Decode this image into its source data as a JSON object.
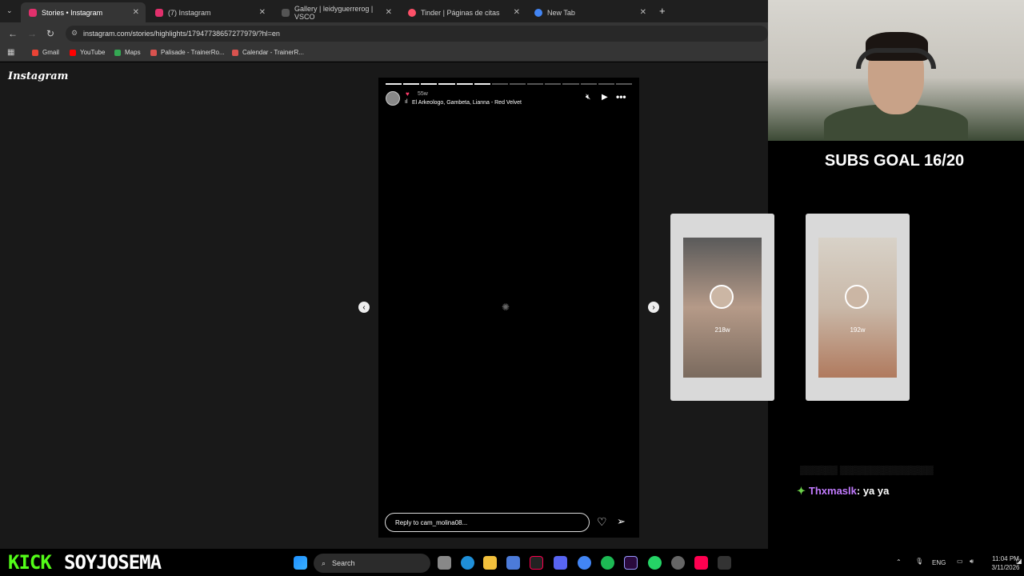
{
  "browser": {
    "tabs": [
      {
        "label": "Stories • Instagram",
        "active": true,
        "color": "#e1306c"
      },
      {
        "label": "(7) Instagram",
        "active": false,
        "color": "#e1306c"
      },
      {
        "label": "Gallery | leidyguerrerog | VSCO",
        "active": false,
        "color": "#333333"
      },
      {
        "label": "Tinder | Páginas de citas",
        "active": false,
        "color": "#fd5068"
      },
      {
        "label": "New Tab",
        "active": false,
        "color": "#4285f4"
      }
    ],
    "url": "instagram.com/stories/highlights/17947738657277979/?hl=en",
    "bookmarks": [
      {
        "label": "Gmail",
        "color": "#ea4335"
      },
      {
        "label": "YouTube",
        "color": "#ff0000"
      },
      {
        "label": "Maps",
        "color": "#34a853"
      },
      {
        "label": "Palisade - TrainerRo...",
        "color": "#d9534f"
      },
      {
        "label": "Calendar - TrainerR...",
        "color": "#d9534f"
      }
    ]
  },
  "instagram": {
    "logo": "Instagram",
    "story": {
      "time": "55w",
      "song": "El Arkeologo, Gambeta, Lianna - Red Velvet",
      "reply_placeholder": "Reply to cam_molina08...",
      "progress_total": 14,
      "progress_done": 6
    },
    "previews": [
      {
        "count": "218w"
      },
      {
        "count": "192w"
      }
    ]
  },
  "stream": {
    "goal": "SUBS GOAL 16/20",
    "chat": {
      "user": "Thxmaslk",
      "message": ": ya ya"
    },
    "kick_logo": "KICK",
    "channel": "SOYJOSEMA"
  },
  "taskbar": {
    "search": "Search",
    "lang": "ENG",
    "time": "11:04 PM",
    "date": "3/11/2026"
  }
}
